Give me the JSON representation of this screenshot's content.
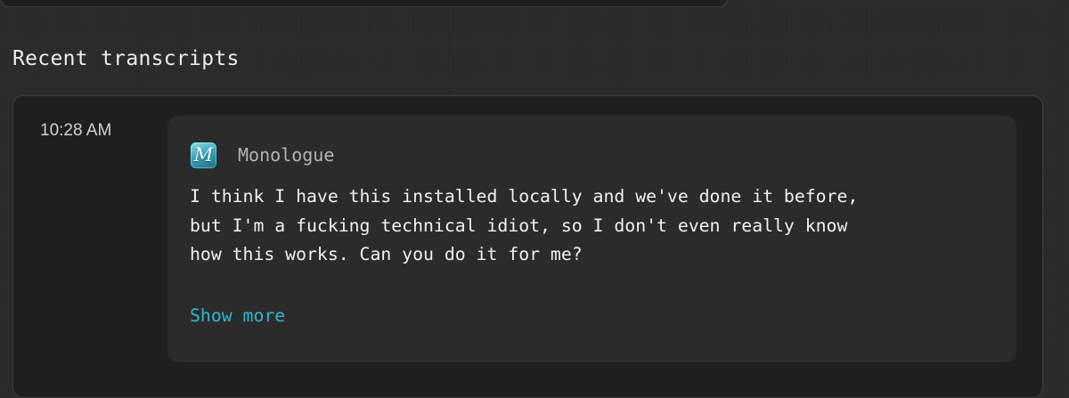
{
  "section": {
    "title": "Recent transcripts"
  },
  "transcripts": [
    {
      "time": "10:28 AM",
      "app": {
        "name": "Monologue",
        "icon": "monologue-app-icon",
        "icon_letter": "M"
      },
      "text_lines": [
        "I think I have this installed locally and we've done it before,",
        "but I'm a fucking technical idiot, so I don't even really know",
        "how this works. Can you do it for me?"
      ],
      "show_more_label": "Show more"
    }
  ],
  "colors": {
    "background": "#2a2a2a",
    "panel": "#1f1f1f",
    "card": "#2b2b2b",
    "accent_link": "#2fb8d0",
    "text_primary": "#f1f1f1",
    "text_secondary": "#b4b4b4"
  }
}
